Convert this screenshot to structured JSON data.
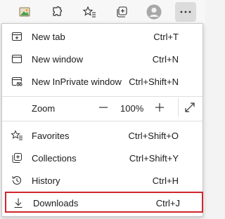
{
  "toolbar": {
    "icons": [
      "image-icon",
      "extensions-icon",
      "favorites-icon",
      "collections-icon",
      "profile-icon",
      "more-icon"
    ]
  },
  "menu": {
    "new_tab": {
      "label": "New tab",
      "shortcut": "Ctrl+T"
    },
    "new_window": {
      "label": "New window",
      "shortcut": "Ctrl+N"
    },
    "new_inprivate": {
      "label": "New InPrivate window",
      "shortcut": "Ctrl+Shift+N"
    },
    "zoom": {
      "label": "Zoom",
      "minus": "—",
      "value": "100%",
      "plus": "+"
    },
    "favorites": {
      "label": "Favorites",
      "shortcut": "Ctrl+Shift+O"
    },
    "collections": {
      "label": "Collections",
      "shortcut": "Ctrl+Shift+Y"
    },
    "history": {
      "label": "History",
      "shortcut": "Ctrl+H"
    },
    "downloads": {
      "label": "Downloads",
      "shortcut": "Ctrl+J"
    }
  },
  "colors": {
    "highlight_border": "#d0262c",
    "menu_bg": "#ffffff",
    "toolbar_bg": "#f7f7f7"
  }
}
